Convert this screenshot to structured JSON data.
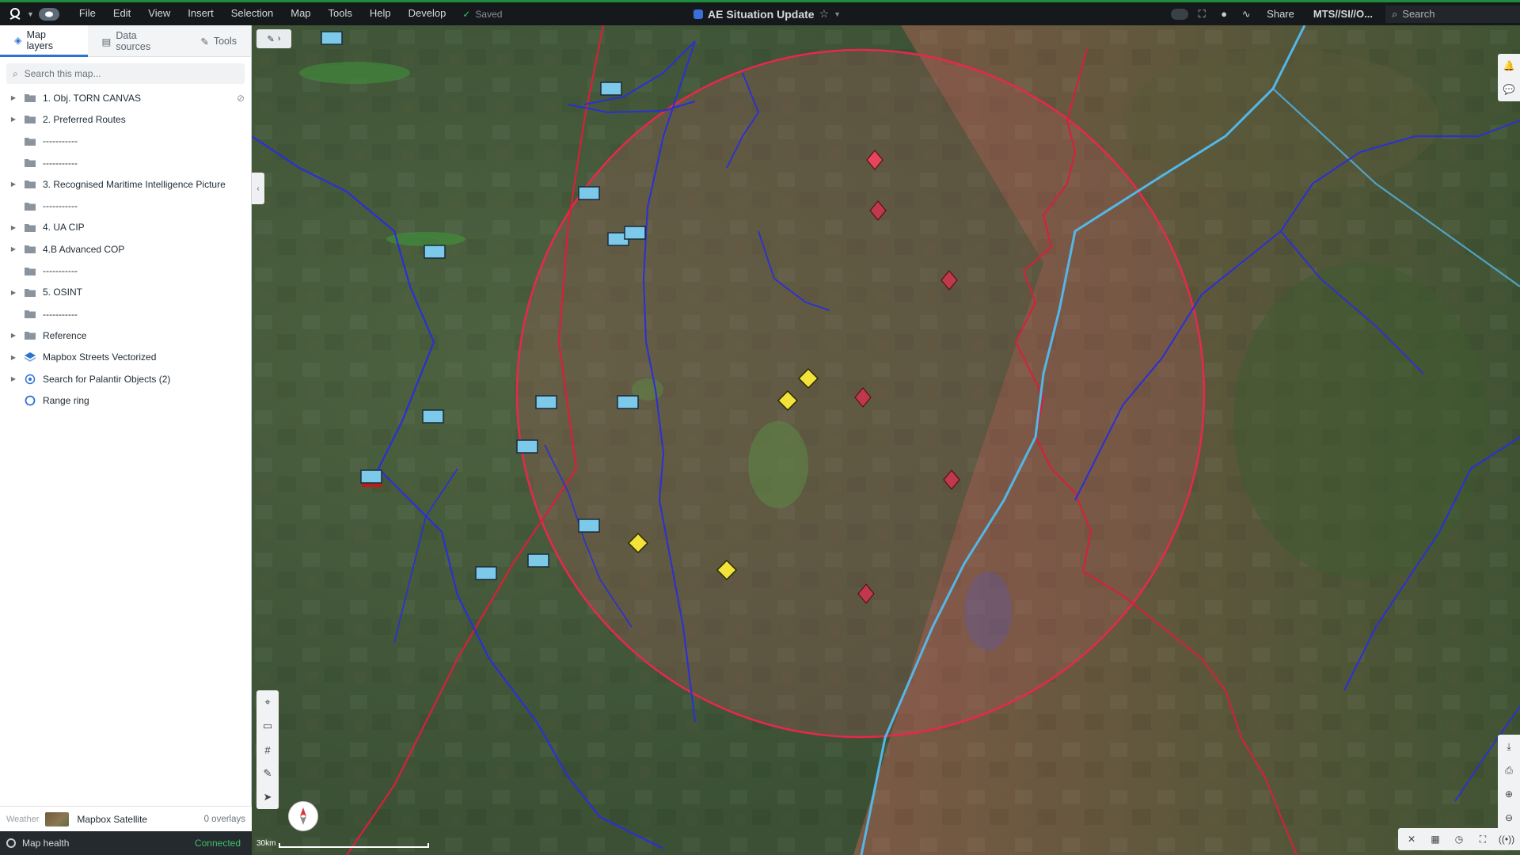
{
  "topbar": {
    "menu": [
      "File",
      "Edit",
      "View",
      "Insert",
      "Selection",
      "Map",
      "Tools",
      "Help",
      "Develop"
    ],
    "saved_label": "Saved",
    "title": "AE Situation Update",
    "share_label": "Share",
    "classification": "MTS//SI//O...",
    "search_placeholder": "Search"
  },
  "sidebar": {
    "tabs": [
      {
        "label": "Map layers",
        "icon": "layers-icon",
        "active": true
      },
      {
        "label": "Data sources",
        "icon": "database-icon",
        "active": false
      },
      {
        "label": "Tools",
        "icon": "wrench-icon",
        "active": false
      }
    ],
    "search_placeholder": "Search this map...",
    "layers": [
      {
        "label": "1. Obj. TORN CANVAS",
        "type": "folder",
        "expandable": true,
        "hidden_icon": true
      },
      {
        "label": "2. Preferred Routes",
        "type": "folder",
        "expandable": true
      },
      {
        "label": "-----------",
        "type": "folder",
        "expandable": false
      },
      {
        "label": "-----------",
        "type": "folder",
        "expandable": false
      },
      {
        "label": "3. Recognised Maritime Intelligence Picture",
        "type": "folder",
        "expandable": true
      },
      {
        "label": "-----------",
        "type": "folder",
        "expandable": false
      },
      {
        "label": "4. UA CIP",
        "type": "folder",
        "expandable": true
      },
      {
        "label": "4.B Advanced COP",
        "type": "folder",
        "expandable": true
      },
      {
        "label": "-----------",
        "type": "folder",
        "expandable": false
      },
      {
        "label": "5. OSINT",
        "type": "folder",
        "expandable": true
      },
      {
        "label": "-----------",
        "type": "folder",
        "expandable": false
      },
      {
        "label": "Reference",
        "type": "folder",
        "expandable": true
      },
      {
        "label": "Mapbox Streets Vectorized",
        "type": "vector",
        "expandable": true
      },
      {
        "label": "Search for Palantir Objects (2)",
        "type": "search",
        "expandable": true
      },
      {
        "label": "Range ring",
        "type": "ring",
        "expandable": false
      }
    ],
    "footer": {
      "weather_label": "Weather",
      "basemap_label": "Mapbox Satellite",
      "overlays_label": "0 overlays"
    },
    "health": {
      "label": "Map health",
      "status": "Connected"
    }
  },
  "map": {
    "scale_label": "30km",
    "compass_label": "N",
    "colors": {
      "ring": "#e8284a",
      "boundary": "#d81f3a",
      "river": "#2b2fd6",
      "road": "#53b7e8",
      "friendly_unit": "#7cc9ea",
      "hostile_unit": "#e8455c",
      "unknown_unit": "#f2e23a"
    }
  }
}
